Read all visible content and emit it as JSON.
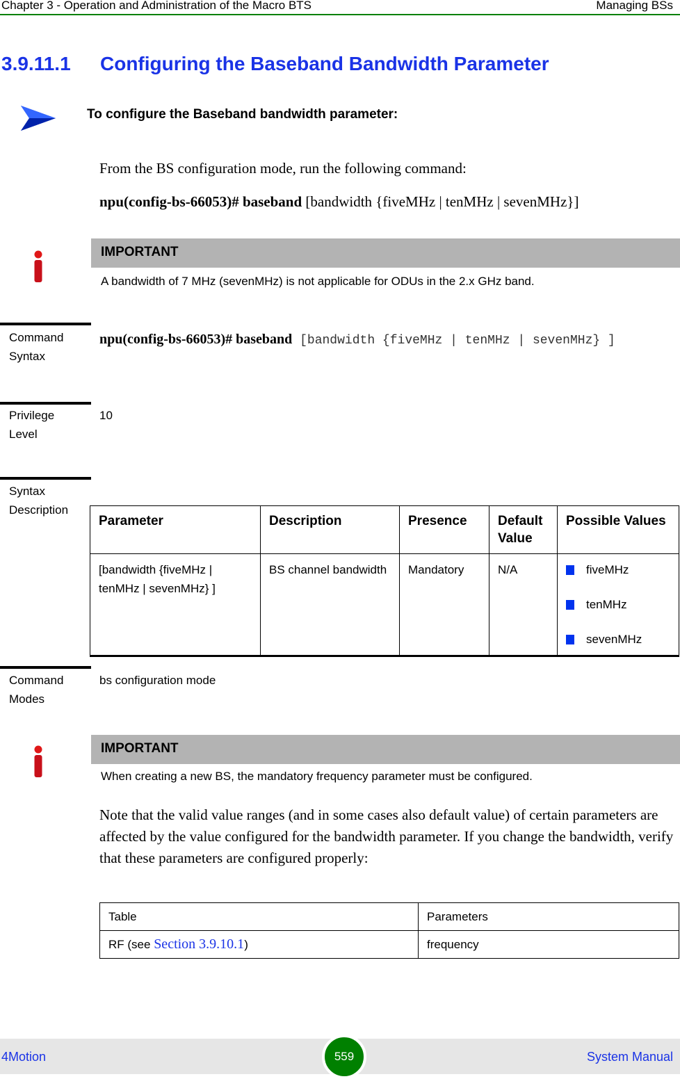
{
  "header": {
    "chapter": "Chapter 3 - Operation and Administration of the Macro BTS",
    "section": "Managing BSs"
  },
  "heading": {
    "number": "3.9.11.1",
    "title": "Configuring the Baseband Bandwidth Parameter"
  },
  "procedure": {
    "intro": "To configure the Baseband bandwidth parameter:",
    "instruction": "From the BS configuration mode, run the following command:",
    "command_bold": "npu(config-bs-66053)# baseband",
    "command_rest": " [bandwidth {fiveMHz | tenMHz | sevenMHz}]"
  },
  "notes": [
    {
      "label": "IMPORTANT",
      "text": "A bandwidth of 7 MHz (sevenMHz) is not applicable for ODUs in the 2.x GHz band."
    },
    {
      "label": "IMPORTANT",
      "text": "When creating a new BS, the mandatory frequency parameter must be configured."
    }
  ],
  "command_syntax": {
    "label_line1": "Command",
    "label_line2": "Syntax",
    "bold": "npu(config-bs-66053)# baseband",
    "mono": " [bandwidth {fiveMHz | tenMHz | sevenMHz} ]"
  },
  "privilege_level": {
    "label_line1": "Privilege",
    "label_line2": "Level",
    "value": "10"
  },
  "syntax_description": {
    "label_line1": "Syntax",
    "label_line2": "Description",
    "columns": [
      "Parameter",
      "Description",
      "Presence",
      "Default Value",
      "Possible Values"
    ],
    "rows": [
      {
        "parameter": "[bandwidth {fiveMHz | tenMHz | sevenMHz} ]",
        "description": "BS channel bandwidth",
        "presence": "Mandatory",
        "default": "N/A",
        "possible_values": [
          "fiveMHz",
          "tenMHz",
          "sevenMHz"
        ]
      }
    ]
  },
  "command_modes": {
    "label_line1": "Command",
    "label_line2": "Modes",
    "value": "bs configuration mode"
  },
  "note_paragraph": "Note that the valid value ranges (and in some cases also default value) of certain parameters are affected by the value configured for the bandwidth parameter. If you change the bandwidth, verify that these parameters are configured properly:",
  "ref_table": {
    "columns": [
      "Table",
      "Parameters"
    ],
    "rows": [
      {
        "table_prefix": "RF (see ",
        "link": "Section 3.9.10.1",
        "table_suffix": ")",
        "parameters": "frequency"
      }
    ]
  },
  "footer": {
    "product": "4Motion",
    "page": "559",
    "doc": "System Manual"
  },
  "colors": {
    "heading": "#1a33e6",
    "header_rule": "#008000",
    "page_badge": "#008000",
    "note_bar": "#b3b3b3",
    "bullet": "#0033ee"
  }
}
